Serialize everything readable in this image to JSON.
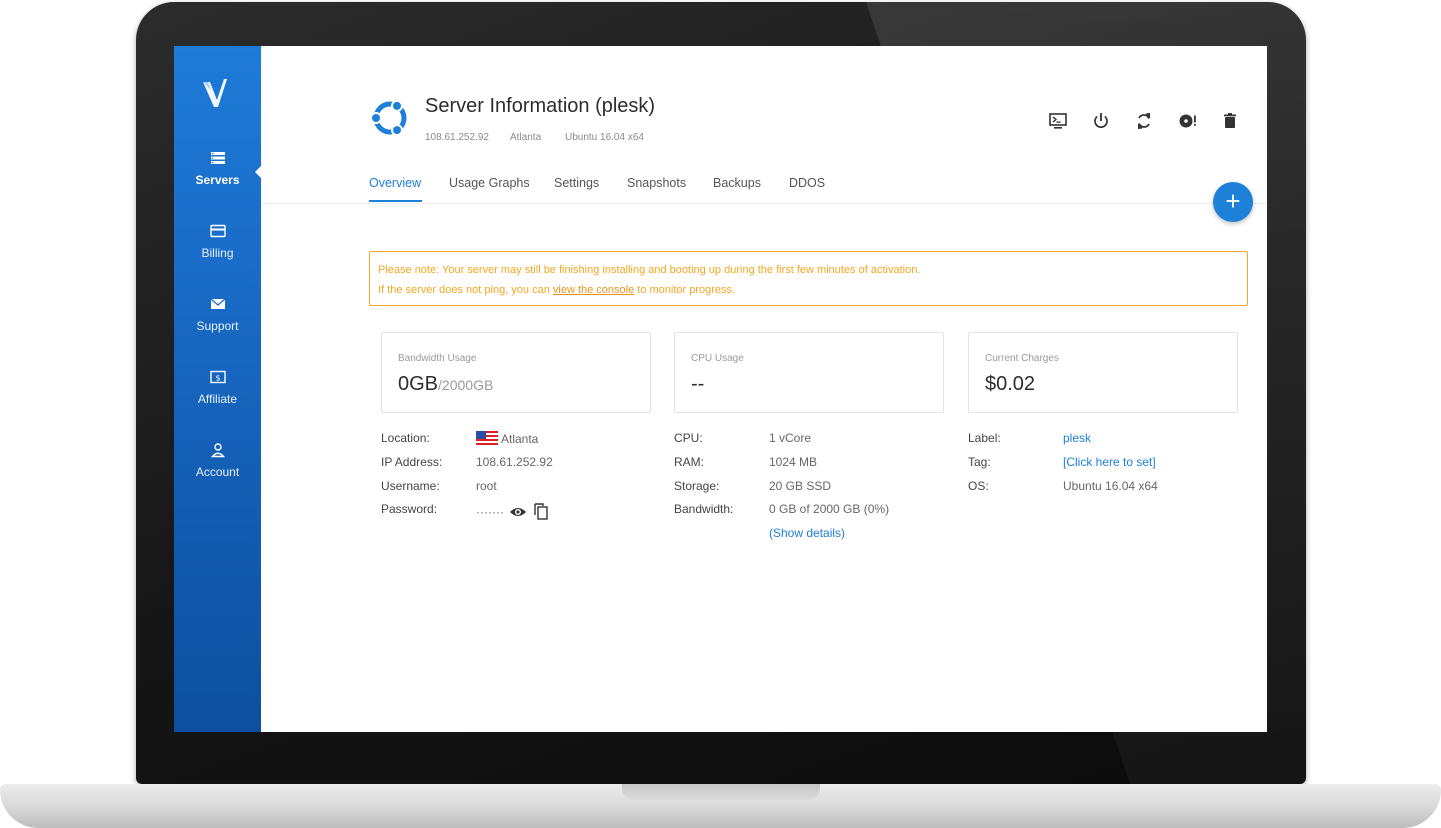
{
  "sidebar": {
    "items": [
      {
        "label": "Servers",
        "icon": "server-list-icon",
        "active": true
      },
      {
        "label": "Billing",
        "icon": "credit-card-icon"
      },
      {
        "label": "Support",
        "icon": "envelope-icon"
      },
      {
        "label": "Affiliate",
        "icon": "dollar-bill-icon"
      },
      {
        "label": "Account",
        "icon": "user-icon"
      }
    ]
  },
  "header": {
    "title": "Server Information (plesk)",
    "ip": "108.61.252.92",
    "location": "Atlanta",
    "os": "Ubuntu 16.04 x64"
  },
  "actions": [
    "console-icon",
    "power-icon",
    "restart-icon",
    "reinstall-icon",
    "trash-icon"
  ],
  "tabs": [
    {
      "label": "Overview",
      "active": true
    },
    {
      "label": "Usage Graphs"
    },
    {
      "label": "Settings"
    },
    {
      "label": "Snapshots"
    },
    {
      "label": "Backups"
    },
    {
      "label": "DDOS"
    }
  ],
  "fab_label": "+",
  "notice": {
    "line1": "Please note: Your server may still be finishing installing and booting up during the first few minutes of activation.",
    "line2_before": "If the server does not ping, you can",
    "line2_link": "view the console",
    "line2_after": "to monitor progress."
  },
  "cards": {
    "bandwidth": {
      "label": "Bandwidth Usage",
      "value": "0GB",
      "sub": "/2000GB"
    },
    "cpu": {
      "label": "CPU Usage",
      "value": "--"
    },
    "charges": {
      "label": "Current Charges",
      "value": "$0.02"
    }
  },
  "details_left": {
    "location": {
      "k": "Location:",
      "v": "Atlanta"
    },
    "ip": {
      "k": "IP Address:",
      "v": "108.61.252.92"
    },
    "username": {
      "k": "Username:",
      "v": "root"
    },
    "password": {
      "k": "Password:",
      "v": "·······"
    }
  },
  "details_mid": {
    "cpu": {
      "k": "CPU:",
      "v": "1 vCore"
    },
    "ram": {
      "k": "RAM:",
      "v": "1024 MB"
    },
    "storage": {
      "k": "Storage:",
      "v": "20 GB SSD"
    },
    "bandwidth": {
      "k": "Bandwidth:",
      "v": "0 GB of 2000 GB (0%)"
    },
    "show_details": "(Show details)"
  },
  "details_right": {
    "label": {
      "k": "Label:",
      "v": "plesk"
    },
    "tag": {
      "k": "Tag:",
      "v": "[Click here to set]"
    },
    "os": {
      "k": "OS:",
      "v": "Ubuntu 16.04 x64"
    }
  },
  "colors": {
    "sidebar_top": "#1e7bd8",
    "sidebar_bottom": "#0d4f9e",
    "accent": "#1e80d8",
    "notice": "#f5a623"
  }
}
